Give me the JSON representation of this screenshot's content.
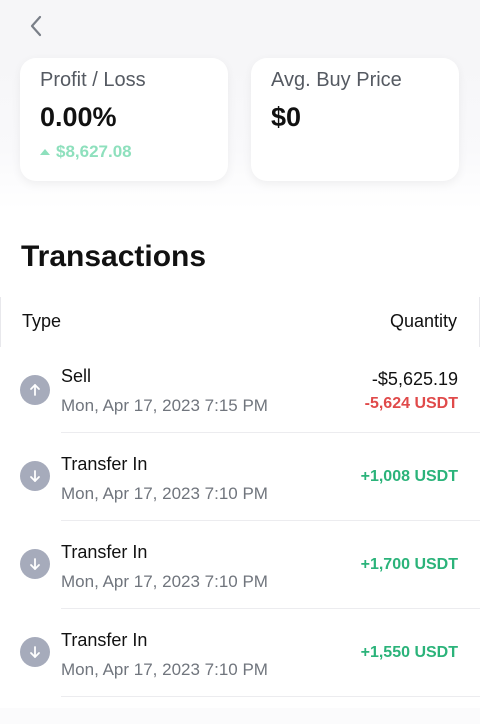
{
  "header": {
    "back_icon": "chevron-left-icon"
  },
  "stats": {
    "profit_loss": {
      "label": "Profit / Loss",
      "value": "0.00%",
      "change": "$8,627.08",
      "change_icon": "triangle-up-icon",
      "change_color": "#8ee0bd"
    },
    "avg_buy_price": {
      "label": "Avg. Buy Price",
      "value": "$0"
    }
  },
  "transactions": {
    "title": "Transactions",
    "columns": {
      "type": "Type",
      "quantity": "Quantity"
    },
    "rows": [
      {
        "type": "Sell",
        "date": "Mon, Apr 17, 2023 7:15 PM",
        "icon": "arrow-up-icon",
        "amount_usd": "-$5,625.19",
        "amount": "-5,624 USDT",
        "amount_color": "#e04a4a"
      },
      {
        "type": "Transfer In",
        "date": "Mon, Apr 17, 2023 7:10 PM",
        "icon": "arrow-down-icon",
        "amount": "+1,008 USDT",
        "amount_color": "#2bb37a"
      },
      {
        "type": "Transfer In",
        "date": "Mon, Apr 17, 2023 7:10 PM",
        "icon": "arrow-down-icon",
        "amount": "+1,700 USDT",
        "amount_color": "#2bb37a"
      },
      {
        "type": "Transfer In",
        "date": "Mon, Apr 17, 2023 7:10 PM",
        "icon": "arrow-down-icon",
        "amount": "+1,550 USDT",
        "amount_color": "#2bb37a"
      }
    ]
  }
}
